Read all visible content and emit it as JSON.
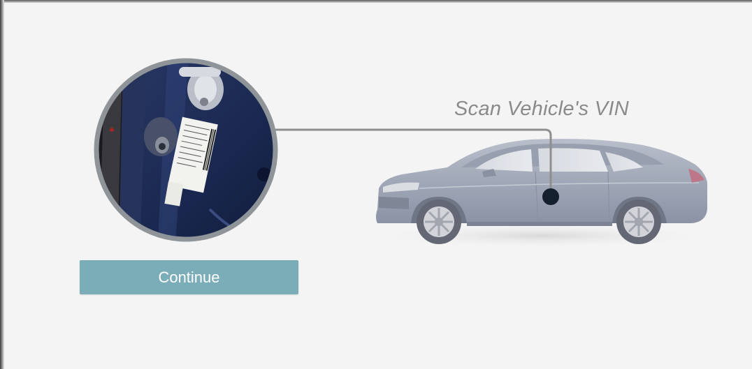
{
  "instruction": {
    "text": "Scan Vehicle's VIN"
  },
  "continue_button": {
    "label": "Continue"
  },
  "colors": {
    "background": "#f4f4f4",
    "button": "#7badb8",
    "button_text": "#ffffff",
    "connector_line": "#8e8e8e",
    "vin_marker": "#15202e",
    "car_body": "#8a93a6",
    "door_panel": "#1d2b52"
  },
  "icons": {
    "vin_location_marker": "filled-circle",
    "door_jamb_photo": "vin-sticker-closeup",
    "vehicle": "sedan-illustration"
  }
}
